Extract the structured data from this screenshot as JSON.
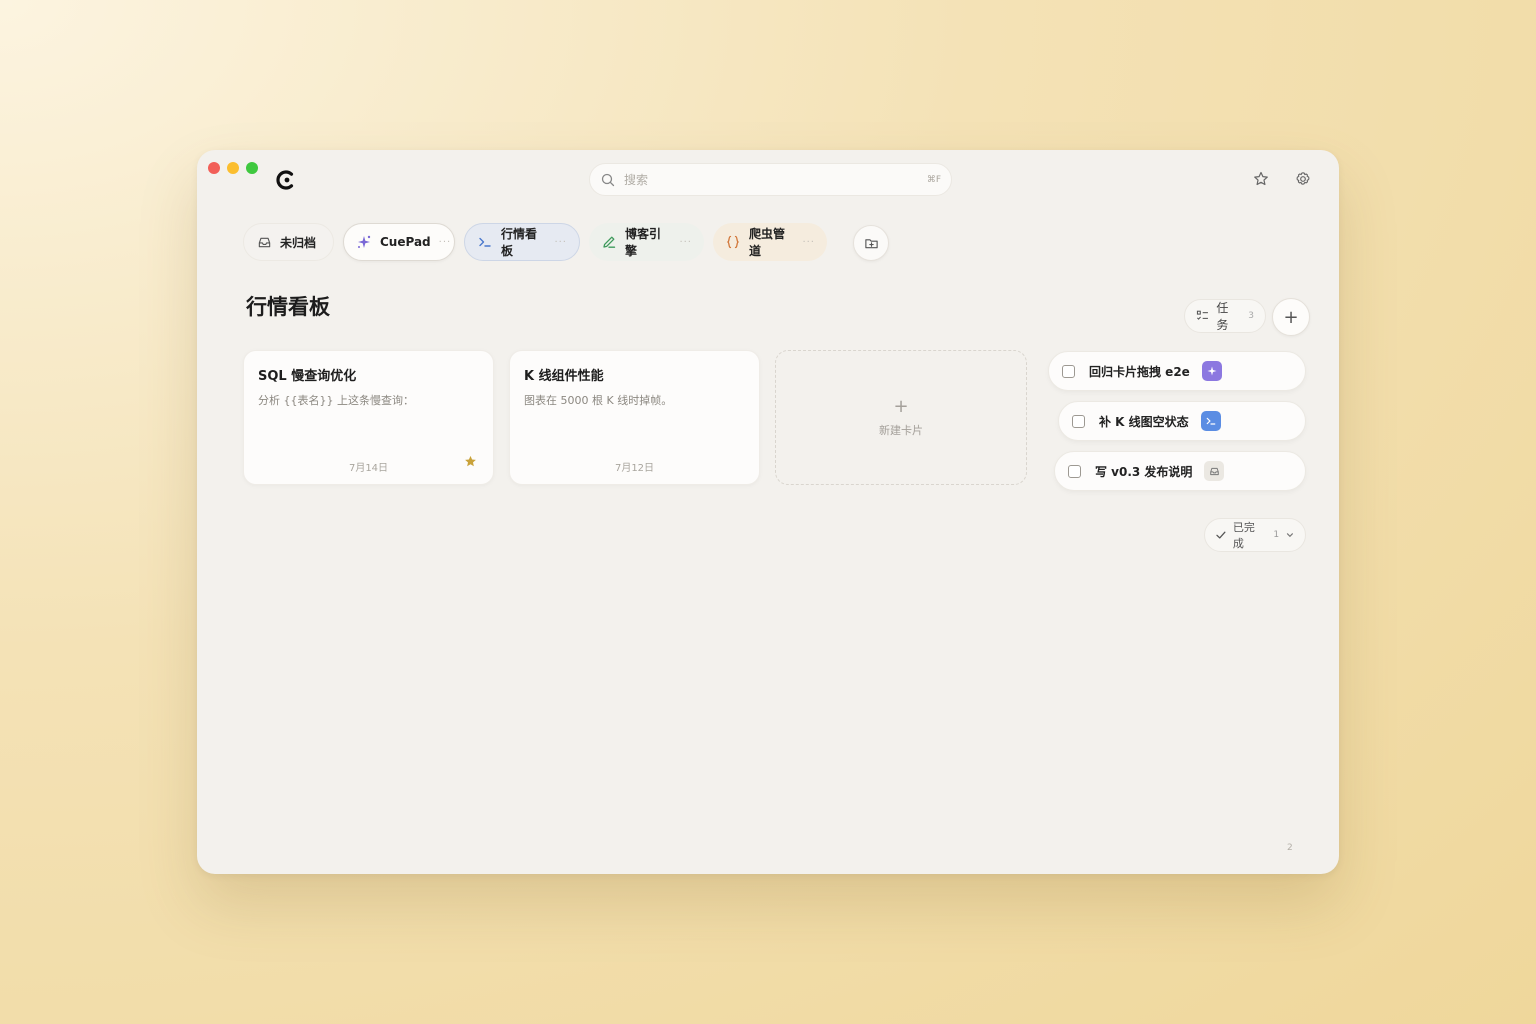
{
  "search": {
    "placeholder": "搜索",
    "shortcut": "⌘F"
  },
  "tabs": [
    {
      "label": "未归档",
      "icon": "inbox-icon"
    },
    {
      "label": "CuePad",
      "icon": "sparkle-icon"
    },
    {
      "label": "行情看板",
      "icon": "terminal-icon",
      "active": true
    },
    {
      "label": "博客引擎",
      "icon": "pen-icon"
    },
    {
      "label": "爬虫管道",
      "icon": "braces-icon"
    }
  ],
  "page": {
    "title": "行情看板"
  },
  "cards": [
    {
      "title": "SQL 慢查询优化",
      "desc": "分析 {{表名}} 上这条慢查询：",
      "date": "7月14日",
      "starred": true
    },
    {
      "title": "K 线组件性能",
      "desc": "图表在 5000 根 K 线时掉帧。",
      "date": "7月12日",
      "starred": false
    }
  ],
  "new_card": {
    "label": "新建卡片"
  },
  "task_header": {
    "label": "任务",
    "count": "3"
  },
  "tasks": [
    {
      "label": "回归卡片拖拽 e2e",
      "badge": "sparkle-icon",
      "badge_color": "#8c78e0"
    },
    {
      "label": "补 K 线图空状态",
      "badge": "terminal-icon",
      "badge_color": "#5b8de3"
    },
    {
      "label": "写 v0.3 发布说明",
      "badge": "inbox-icon",
      "badge_color": "#ebe8e2"
    }
  ],
  "completed": {
    "label": "已完成",
    "count": "1"
  },
  "page_number": "2",
  "colors": {
    "accent_blue": "#5b8de3",
    "accent_purple": "#8c78e0",
    "star": "#c9a23a"
  }
}
